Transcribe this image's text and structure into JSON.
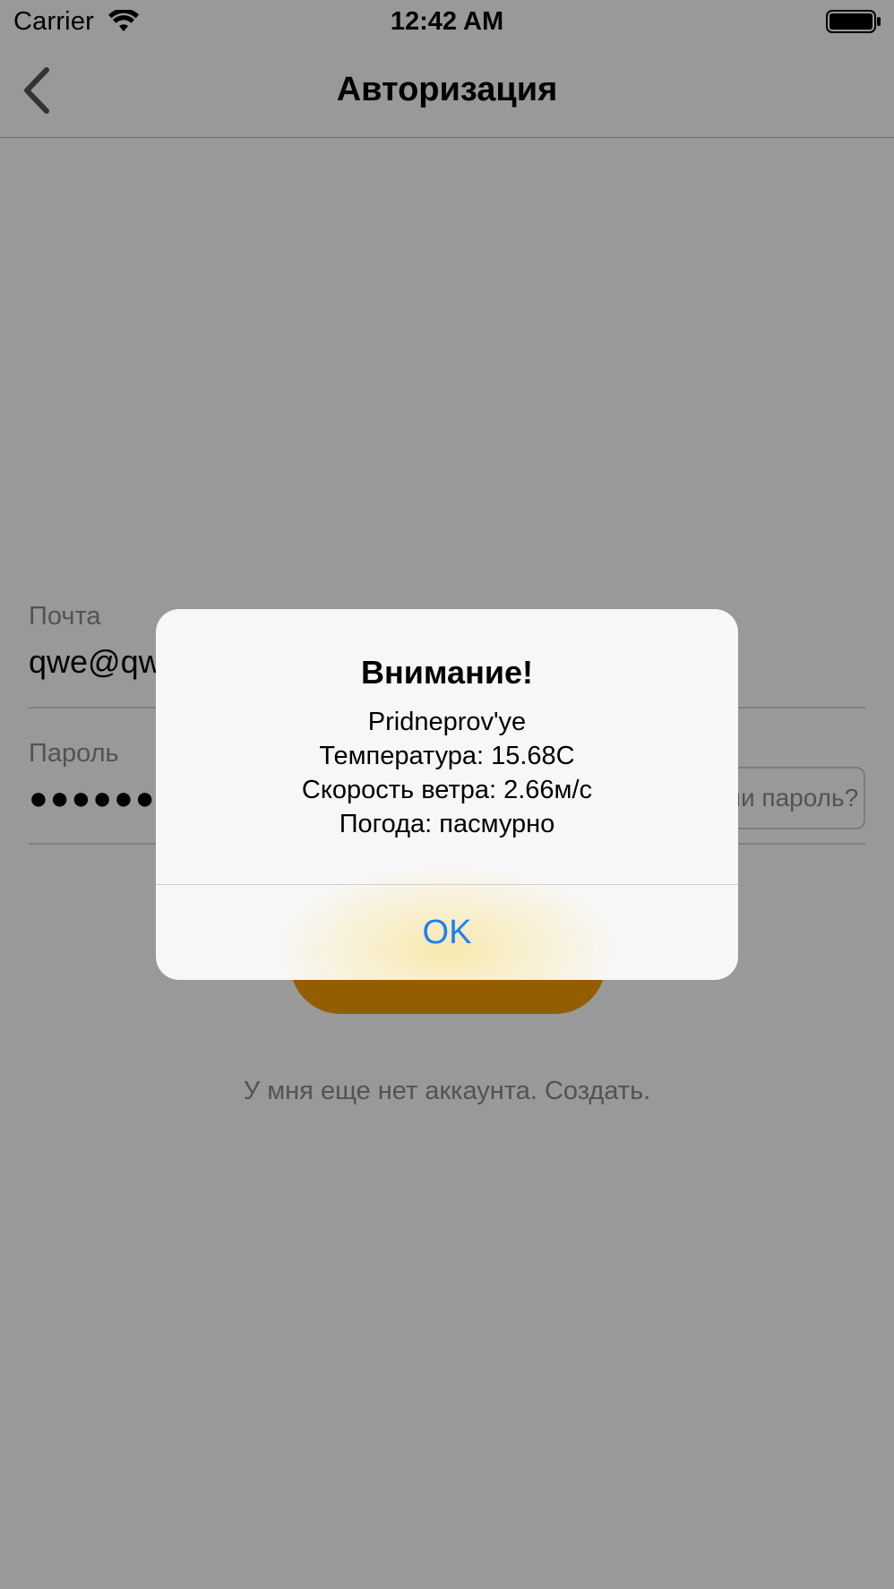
{
  "status_bar": {
    "carrier": "Carrier",
    "time": "12:42 AM",
    "wifi_icon": "wifi-icon",
    "battery_icon": "battery-icon"
  },
  "nav": {
    "title": "Авторизация",
    "back_icon": "chevron-left-icon"
  },
  "form": {
    "email_label": "Почта",
    "email_value": "qwe@qw",
    "password_label": "Пароль",
    "password_value": "●●●●●●",
    "forgot_label": "Забыли пароль?",
    "login_label": "",
    "signup_text": "У мня еще нет аккаунта. Создать."
  },
  "alert": {
    "title": "Внимание!",
    "lines": [
      "Pridneprov'ye",
      "Температура: 15.68C",
      "Скорость ветра: 2.66м/с",
      "Погода: пасмурно"
    ],
    "ok_label": "OK"
  },
  "colors": {
    "accent": "#f59c00",
    "alert_button": "#1a82f5",
    "overlay": "rgba(0,0,0,0.4)"
  }
}
